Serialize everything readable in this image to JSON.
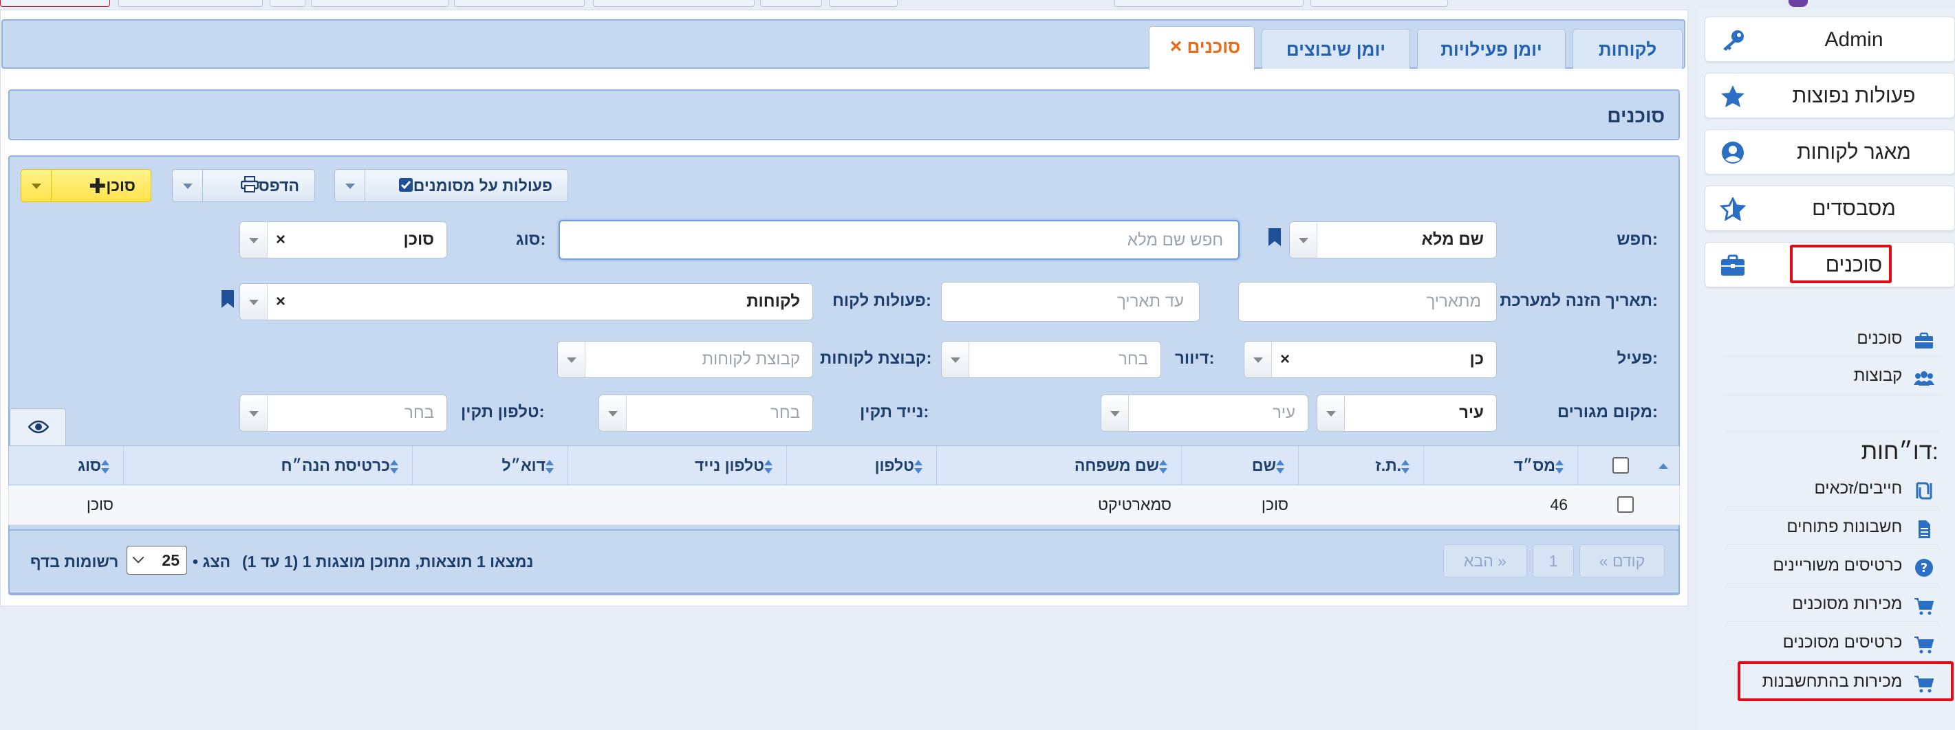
{
  "sidebar": {
    "admin": "Admin",
    "popular_actions": "פעולות נפוצות",
    "customers_db": "מאגר לקוחות",
    "distributors": "מסבסדים",
    "agents": "סוכנים",
    "sub_agents": "סוכנים",
    "sub_groups": "קבוצות",
    "reports_title": "דו״חות:",
    "reports": [
      "חייבים/זכאים",
      "חשבונות פתוחים",
      "כרטיסים משוריינים",
      "מכירות מסוכנים",
      "כרטיסים מסוכנים",
      "מכירות בהתחשבנות"
    ]
  },
  "tabs": {
    "customers": "לקוחות",
    "activity_log": "יומן פעילויות",
    "assignments_log": "יומן שיבוצים",
    "agents": "סוכנים",
    "close": "×"
  },
  "section": {
    "title": "סוכנים"
  },
  "toolbar": {
    "add_agent": "סוכן",
    "print": "הדפס",
    "bulk_actions": "פעולות על מסומנים"
  },
  "filters": {
    "search_label": "חפש:",
    "search_field_select": "שם מלא",
    "search_placeholder": "חפש שם מלא",
    "type_label": "סוג:",
    "type_value": "סוכן",
    "entry_date_label": "תאריך הזנה למערכת:",
    "from_date_placeholder": "מתאריך",
    "to_date_placeholder": "עד תאריך",
    "customer_actions_label": "פעולות לקוח:",
    "customer_actions_value": "לקוחות",
    "active_label": "פעיל:",
    "active_value": "כן",
    "mailing_label": "דיוור:",
    "mailing_placeholder": "בחר",
    "customer_group_label": "קבוצת לקוחות:",
    "customer_group_placeholder": "קבוצת לקוחות",
    "residence_label": "מקום מגורים:",
    "residence_select": "עיר",
    "residence_placeholder": "עיר",
    "valid_mobile_label": "נייד תקין:",
    "valid_mobile_placeholder": "בחר",
    "valid_phone_label": "טלפון תקין:",
    "valid_phone_placeholder": "בחר",
    "clear": "×"
  },
  "table": {
    "columns": [
      "מס״ד",
      "ת.ז.",
      "שם",
      "שם משפחה",
      "טלפון",
      "טלפון נייד",
      "דוא״ל",
      "כרטיסת הנה״ח",
      "סוג"
    ],
    "rows": [
      {
        "id": "46",
        "tz": "",
        "name": "סוכן",
        "last": "סמארטיקט",
        "phone": "",
        "mobile": "",
        "email": "",
        "account": "",
        "type": "סוכן"
      }
    ]
  },
  "pager": {
    "prev": "« קודם",
    "page": "1",
    "next": "הבא »",
    "info": "נמצאו 1 תוצאות, מתוכן מוצגות 1 (1 עד 1)",
    "show": "• הצג",
    "page_size": "25",
    "per_page": "רשומות בדף"
  },
  "colors": {
    "accent_orange": "#ea6b15",
    "link_blue": "#2262b2",
    "highlight_red": "#e20c18"
  }
}
